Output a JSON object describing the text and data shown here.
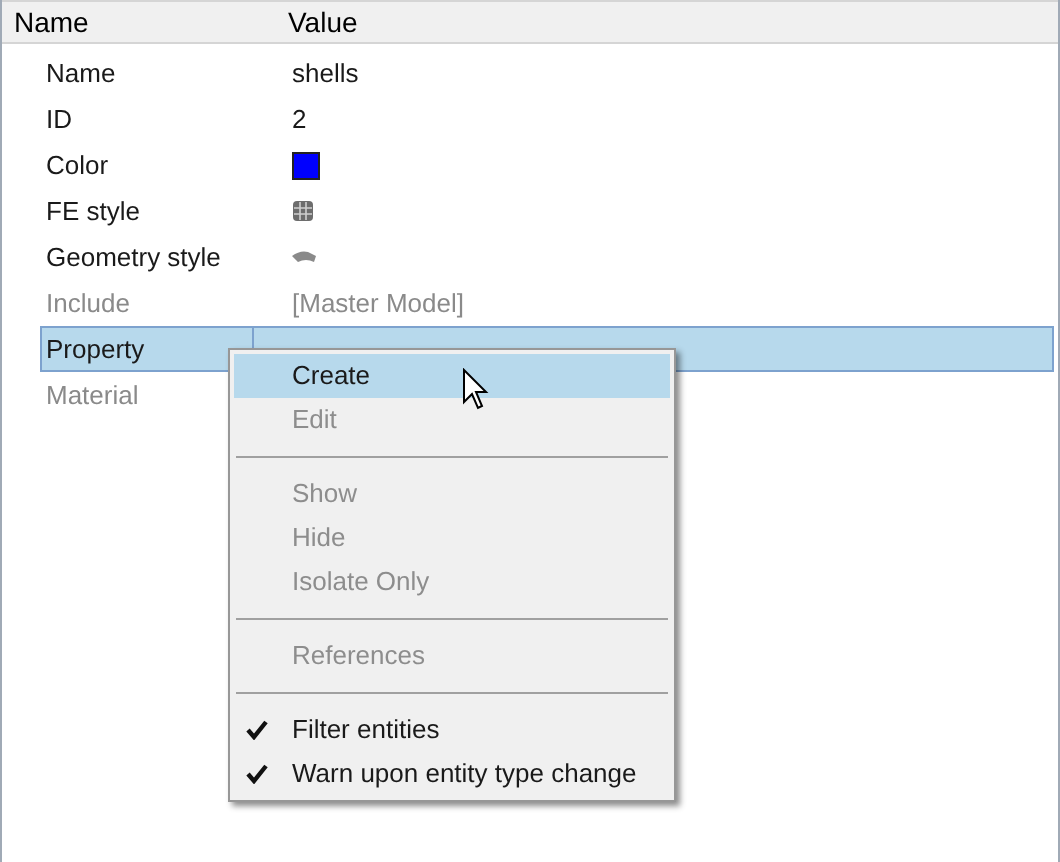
{
  "columns": [
    "Name",
    "Value"
  ],
  "rows": [
    {
      "name": "Name",
      "kind": "text",
      "value": "shells",
      "disabled": false,
      "selected": false
    },
    {
      "name": "ID",
      "kind": "text",
      "value": "2",
      "disabled": false,
      "selected": false
    },
    {
      "name": "Color",
      "kind": "swatch",
      "color": "#0000ff",
      "disabled": false,
      "selected": false
    },
    {
      "name": "FE style",
      "kind": "fe-icon",
      "disabled": false,
      "selected": false
    },
    {
      "name": "Geometry style",
      "kind": "geom-icon",
      "disabled": false,
      "selected": false
    },
    {
      "name": "Include",
      "kind": "text",
      "value": "[Master Model]",
      "disabled": true,
      "selected": false
    },
    {
      "name": "Property",
      "kind": "empty",
      "disabled": false,
      "selected": true
    },
    {
      "name": "Material",
      "kind": "empty",
      "disabled": true,
      "selected": false
    }
  ],
  "context_menu": [
    {
      "kind": "item",
      "label": "Create",
      "disabled": false,
      "selected": true
    },
    {
      "kind": "item",
      "label": "Edit",
      "disabled": true,
      "selected": false
    },
    {
      "kind": "separator"
    },
    {
      "kind": "item",
      "label": "Show",
      "disabled": true,
      "selected": false
    },
    {
      "kind": "item",
      "label": "Hide",
      "disabled": true,
      "selected": false
    },
    {
      "kind": "item",
      "label": "Isolate Only",
      "disabled": true,
      "selected": false
    },
    {
      "kind": "separator"
    },
    {
      "kind": "item",
      "label": "References",
      "disabled": true,
      "selected": false
    },
    {
      "kind": "separator"
    },
    {
      "kind": "check",
      "label": "Filter entities",
      "checked": true,
      "disabled": false,
      "selected": false
    },
    {
      "kind": "check",
      "label": "Warn upon entity type change",
      "checked": true,
      "disabled": false,
      "selected": false
    }
  ]
}
